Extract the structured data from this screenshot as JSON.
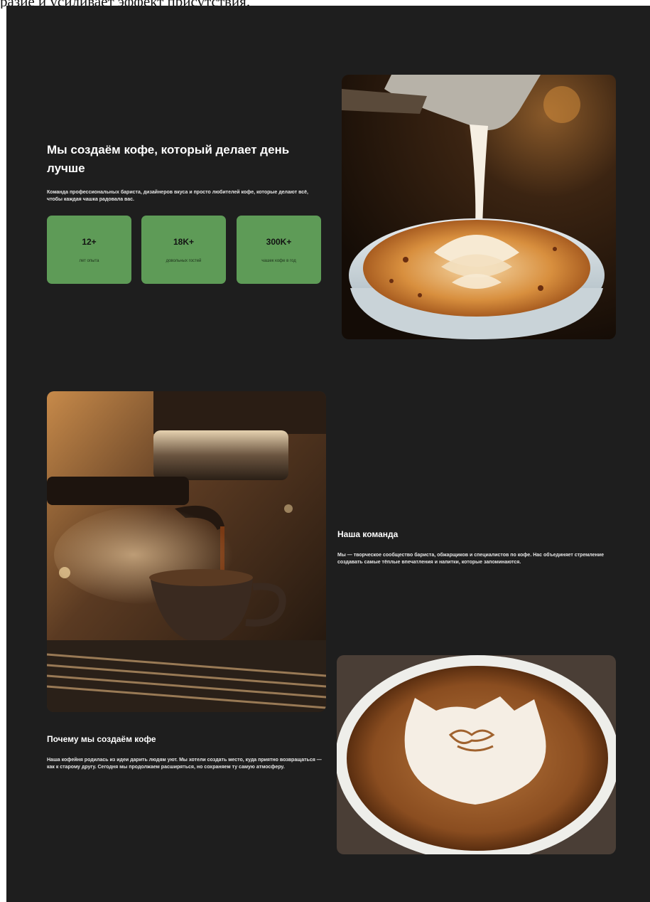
{
  "top_caption": "разие и усиливает эффект присутствия.",
  "hero": {
    "title": "Мы создаём кофе, который делает день лучше",
    "subtitle": "Команда профессиональных бариста, дизайнеров вкуса и просто любителей кофе, которые делают всё, чтобы каждая чашка радовала вас."
  },
  "stats": [
    {
      "value": "12+",
      "label": "лет опыта"
    },
    {
      "value": "18K+",
      "label": "довольных гостей"
    },
    {
      "value": "300K+",
      "label": "чашек кофе в год"
    }
  ],
  "team": {
    "title": "Наша команда",
    "text": "Мы — творческое сообщество бариста, обжарщиков и специалистов по кофе. Нас объединяет стремление создавать самые тёплые впечатления и напитки, которые запоминаются."
  },
  "why": {
    "title": "Почему мы создаём кофе",
    "text": "Наша кофейня родилась из идеи дарить людям уют. Мы хотели создать место, куда приятно возвращаться — как к старому другу. Сегодня мы продолжаем расширяться, но сохраняем ту самую атмосферу."
  },
  "colors": {
    "background": "#1e1e1e",
    "accent_green": "#5e9b57",
    "text": "#ffffff"
  },
  "images": [
    {
      "name": "latte-pour-photo"
    },
    {
      "name": "espresso-machine-photo"
    },
    {
      "name": "cat-latte-art-photo"
    }
  ]
}
